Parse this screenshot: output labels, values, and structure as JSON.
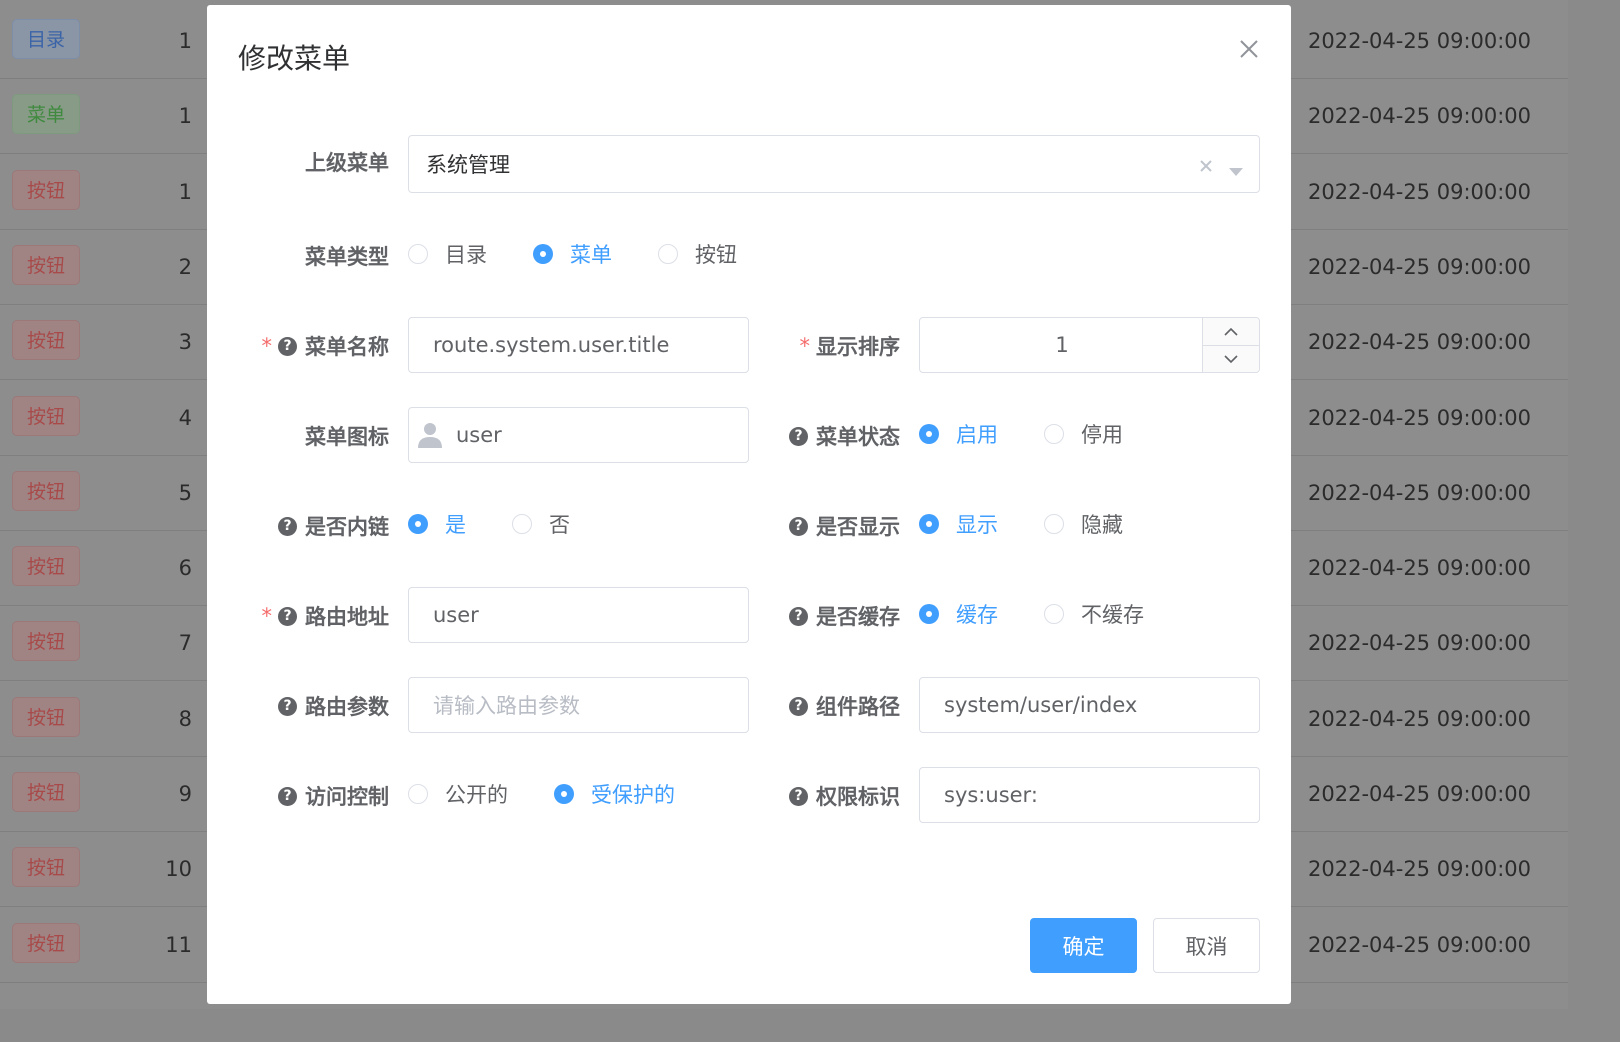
{
  "background_table": {
    "rows": [
      {
        "tag": "目录",
        "tag_type": "dir",
        "order": "1",
        "time": "2022-04-25 09:00:00"
      },
      {
        "tag": "菜单",
        "tag_type": "menu",
        "order": "1",
        "time": "2022-04-25 09:00:00"
      },
      {
        "tag": "按钮",
        "tag_type": "btn",
        "order": "1",
        "time": "2022-04-25 09:00:00"
      },
      {
        "tag": "按钮",
        "tag_type": "btn",
        "order": "2",
        "time": "2022-04-25 09:00:00"
      },
      {
        "tag": "按钮",
        "tag_type": "btn",
        "order": "3",
        "time": "2022-04-25 09:00:00"
      },
      {
        "tag": "按钮",
        "tag_type": "btn",
        "order": "4",
        "time": "2022-04-25 09:00:00"
      },
      {
        "tag": "按钮",
        "tag_type": "btn",
        "order": "5",
        "time": "2022-04-25 09:00:00"
      },
      {
        "tag": "按钮",
        "tag_type": "btn",
        "order": "6",
        "time": "2022-04-25 09:00:00"
      },
      {
        "tag": "按钮",
        "tag_type": "btn",
        "order": "7",
        "time": "2022-04-25 09:00:00"
      },
      {
        "tag": "按钮",
        "tag_type": "btn",
        "order": "8",
        "time": "2022-04-25 09:00:00"
      },
      {
        "tag": "按钮",
        "tag_type": "btn",
        "order": "9",
        "time": "2022-04-25 09:00:00"
      },
      {
        "tag": "按钮",
        "tag_type": "btn",
        "order": "10",
        "time": "2022-04-25 09:00:00"
      },
      {
        "tag": "按钮",
        "tag_type": "btn",
        "order": "11",
        "time": "2022-04-25 09:00:00"
      }
    ]
  },
  "dialog": {
    "title": "修改菜单",
    "parent_menu": {
      "label": "上级菜单",
      "value": "系统管理"
    },
    "menu_type": {
      "label": "菜单类型",
      "options": [
        "目录",
        "菜单",
        "按钮"
      ],
      "selected": "菜单"
    },
    "menu_name": {
      "label": "菜单名称",
      "value": "route.system.user.title"
    },
    "display_order": {
      "label": "显示排序",
      "value": "1"
    },
    "menu_icon": {
      "label": "菜单图标",
      "value": "user",
      "icon": "user-icon"
    },
    "menu_status": {
      "label": "菜单状态",
      "options": [
        "启用",
        "停用"
      ],
      "selected": "启用"
    },
    "is_iframe": {
      "label": "是否内链",
      "options": [
        "是",
        "否"
      ],
      "selected": "是"
    },
    "is_visible": {
      "label": "是否显示",
      "options": [
        "显示",
        "隐藏"
      ],
      "selected": "显示"
    },
    "route_path": {
      "label": "路由地址",
      "value": "user"
    },
    "is_cache": {
      "label": "是否缓存",
      "options": [
        "缓存",
        "不缓存"
      ],
      "selected": "缓存"
    },
    "route_params": {
      "label": "路由参数",
      "value": "",
      "placeholder": "请输入路由参数"
    },
    "component_path": {
      "label": "组件路径",
      "value": "system/user/index"
    },
    "access_control": {
      "label": "访问控制",
      "options": [
        "公开的",
        "受保护的"
      ],
      "selected": "受保护的"
    },
    "permission": {
      "label": "权限标识",
      "value": "sys:user:"
    },
    "confirm_label": "确定",
    "cancel_label": "取消"
  },
  "colors": {
    "primary": "#409eff",
    "required": "#f56c6c"
  }
}
